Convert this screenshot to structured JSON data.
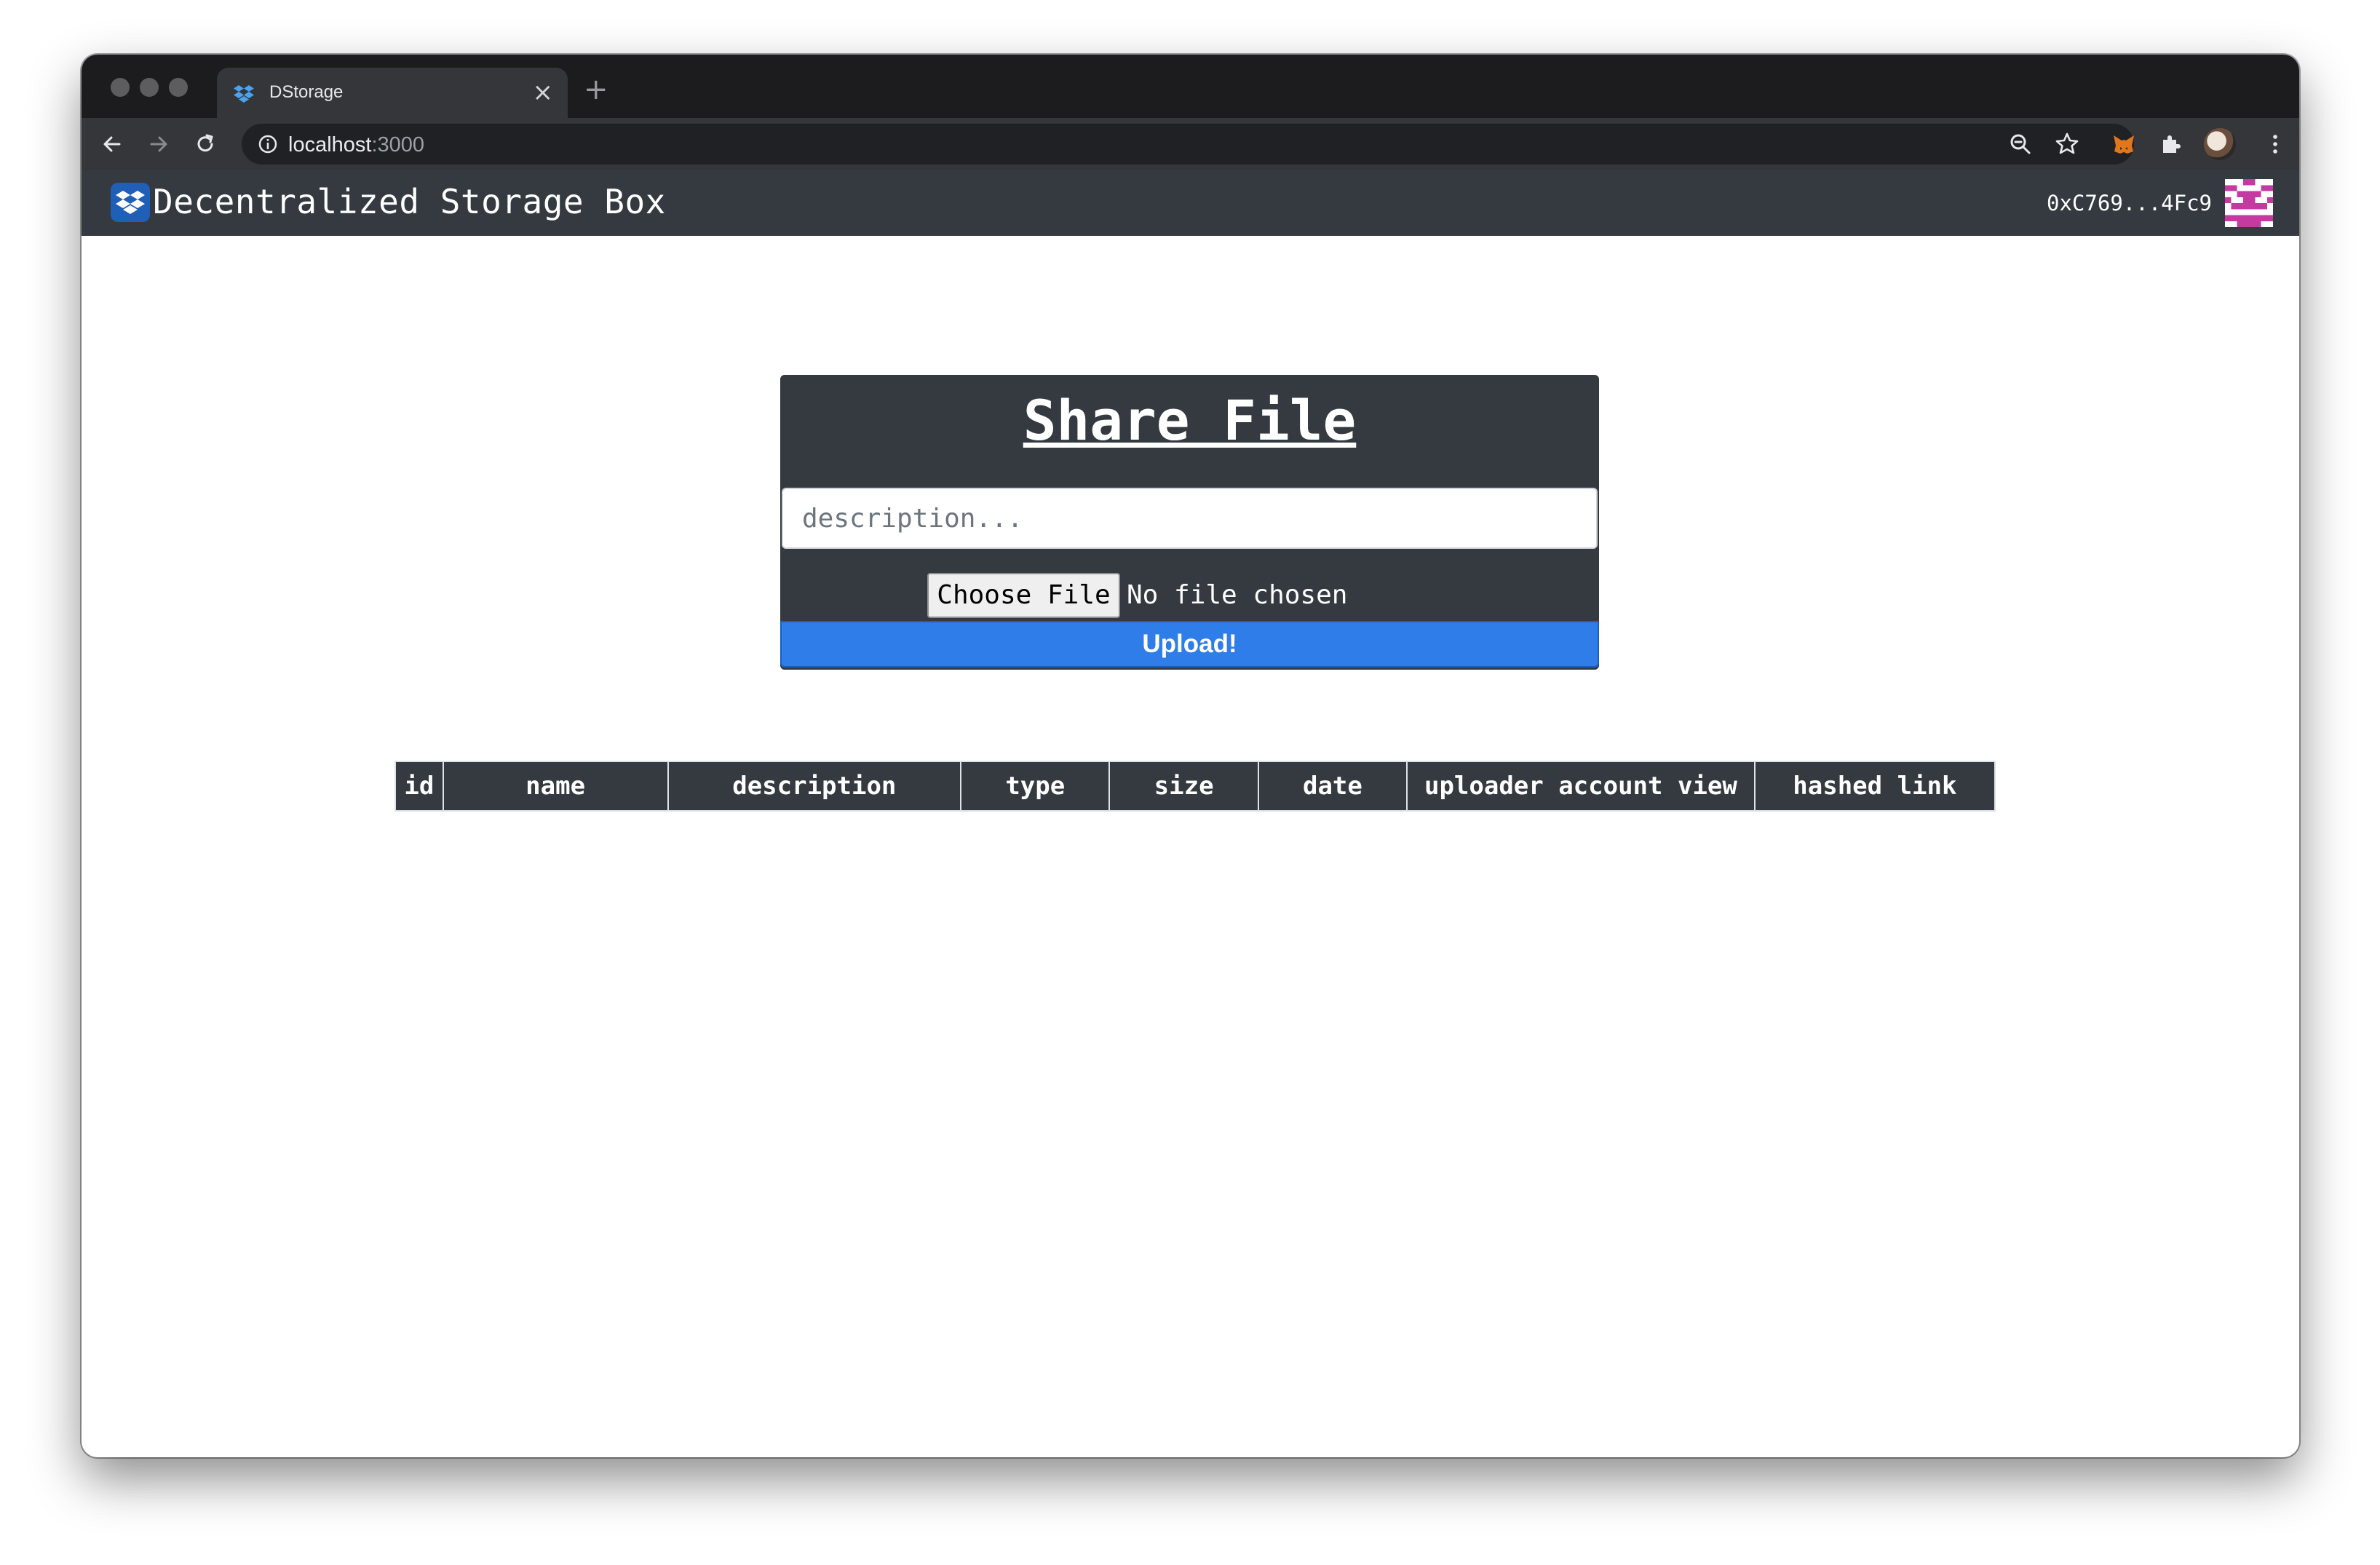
{
  "browser": {
    "tab": {
      "title": "DStorage",
      "close": "×"
    },
    "new_tab": "+",
    "url_host": "localhost",
    "url_port": ":3000"
  },
  "navbar": {
    "brand": "Decentralized Storage Box",
    "account": "0xC769...4Fc9"
  },
  "share": {
    "title": "Share File",
    "description_placeholder": "description...",
    "choose_file_label": "Choose File",
    "file_status": "No file chosen",
    "upload_label": "Upload!"
  },
  "table": {
    "columns": [
      "id",
      "name",
      "description",
      "type",
      "size",
      "date",
      "uploader account view",
      "hashed link"
    ]
  },
  "colors": {
    "navbar": "#343a40",
    "upload": "#2f7de8",
    "identicon": "#c33ba0"
  }
}
